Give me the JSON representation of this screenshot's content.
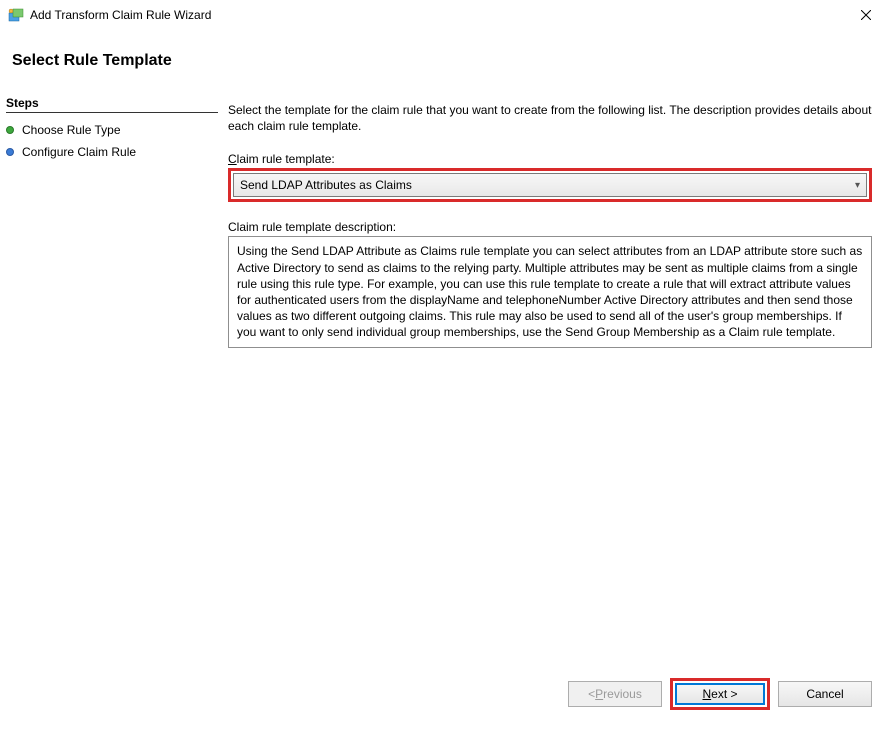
{
  "titlebar": {
    "title": "Add Transform Claim Rule Wizard"
  },
  "heading": "Select Rule Template",
  "sidebar": {
    "title": "Steps",
    "steps": [
      {
        "label": "Choose Rule Type",
        "state": "done"
      },
      {
        "label": "Configure Claim Rule",
        "state": "pending"
      }
    ]
  },
  "main": {
    "instruction": "Select the template for the claim rule that you want to create from the following list. The description provides details about each claim rule template.",
    "template_label_pre": "C",
    "template_label_post": "laim rule template:",
    "dropdown_value": "Send LDAP Attributes as Claims",
    "description_label": "Claim rule template description:",
    "description_text": "Using the Send LDAP Attribute as Claims rule template you can select attributes from an LDAP attribute store such as Active Directory to send as claims to the relying party. Multiple attributes may be sent as multiple claims from a single rule using this rule type. For example, you can use this rule template to create a rule that will extract attribute values for authenticated users from the displayName and telephoneNumber Active Directory attributes and then send those values as two different outgoing claims. This rule may also be used to send all of the user's group memberships. If you want to only send individual group memberships, use the Send Group Membership as a Claim rule template."
  },
  "buttons": {
    "previous_pre": "< ",
    "previous_underline": "P",
    "previous_post": "revious",
    "next_underline": "N",
    "next_post": "ext >",
    "cancel": "Cancel"
  }
}
